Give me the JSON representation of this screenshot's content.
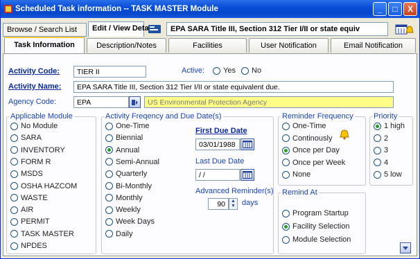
{
  "window": {
    "title": "Scheduled Task information -- TASK MASTER Module",
    "buttons": [
      "_",
      "□",
      "X"
    ]
  },
  "top_tabs": [
    "Browse / Search List",
    "Edit / View Detail"
  ],
  "record_title": "EPA SARA Title III, Section 312 Tier I/II or state equiv",
  "sub_tabs": [
    "Task Information",
    "Description/Notes",
    "Facilities",
    "User Notification",
    "Email Notification"
  ],
  "form": {
    "activity_code_label": "Activity Code:",
    "activity_code": "TIER II",
    "active_label": "Active:",
    "active_yes": "Yes",
    "active_no": "No",
    "activity_name_label": "Activity Name:",
    "activity_name": "EPA SARA Title III, Section 312 Tier I/II or state equivalent due.",
    "agency_code_label": "Agency Code:",
    "agency_code": "EPA",
    "agency_name": "US Environmental Protection Agency"
  },
  "applicable_module": {
    "title": "Applicable Module",
    "options": [
      "No Module",
      "SARA",
      "INVENTORY",
      "FORM R",
      "MSDS",
      "OSHA HAZCOM",
      "WASTE",
      "AIR",
      "PERMIT",
      "TASK MASTER",
      "NPDES"
    ],
    "selected": ""
  },
  "frequency": {
    "title": "Activity Freqency and Due Date(s)",
    "options": [
      "One-Time",
      "Biennial",
      "Annual",
      "Semi-Annual",
      "Quarterly",
      "Bi-Monthly",
      "Monthly",
      "Weekly",
      "Week Days",
      "Daily"
    ],
    "selected": "Annual",
    "first_due_label": "First Due Date",
    "first_due_value": "03/01/1988",
    "last_due_label": "Last Due Date",
    "last_due_value": "/ /",
    "advanced_label": "Advanced Reminder(s)",
    "advanced_value": "90",
    "advanced_unit": "days"
  },
  "reminder": {
    "title": "Reminder Frequency",
    "options": [
      "One-Time",
      "Continously",
      "Once per Day",
      "Once per Week",
      "None"
    ],
    "selected": "Once per Day"
  },
  "priority": {
    "title": "Priority",
    "options": [
      "1 high",
      "2",
      "3",
      "4",
      "5 low"
    ],
    "selected": "1 high"
  },
  "remind_at": {
    "title": "Remind At",
    "options": [
      "Program Startup",
      "Facility Selection",
      "Module Selection"
    ],
    "selected": "Facility Selection"
  }
}
